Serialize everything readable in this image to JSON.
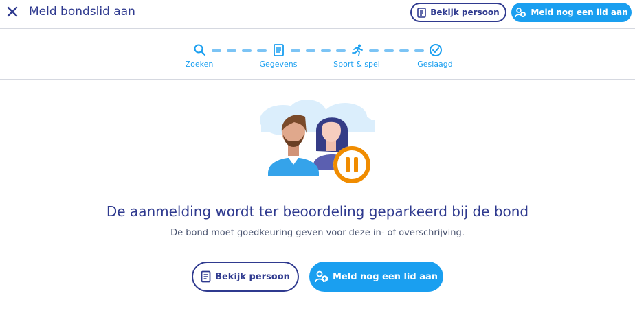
{
  "header": {
    "title": "Meld bondslid aan",
    "view_person_label": "Bekijk persoon",
    "add_member_label": "Meld nog een lid aan"
  },
  "steps": [
    {
      "label": "Zoeken",
      "icon": "search-icon"
    },
    {
      "label": "Gegevens",
      "icon": "document-icon"
    },
    {
      "label": "Sport & spel",
      "icon": "running-icon"
    },
    {
      "label": "Geslaagd",
      "icon": "check-circle-icon"
    }
  ],
  "main": {
    "title": "De aanmelding wordt ter beoordeling geparkeerd bij de bond",
    "subtitle": "De bond moet goedkeuring geven voor deze in- of overschrijving.",
    "view_person_label": "Bekijk persoon",
    "add_member_label": "Meld nog een lid aan"
  },
  "colors": {
    "primary": "#2f3a8f",
    "accent": "#1a9ff0",
    "pause_orange": "#f08c00"
  }
}
